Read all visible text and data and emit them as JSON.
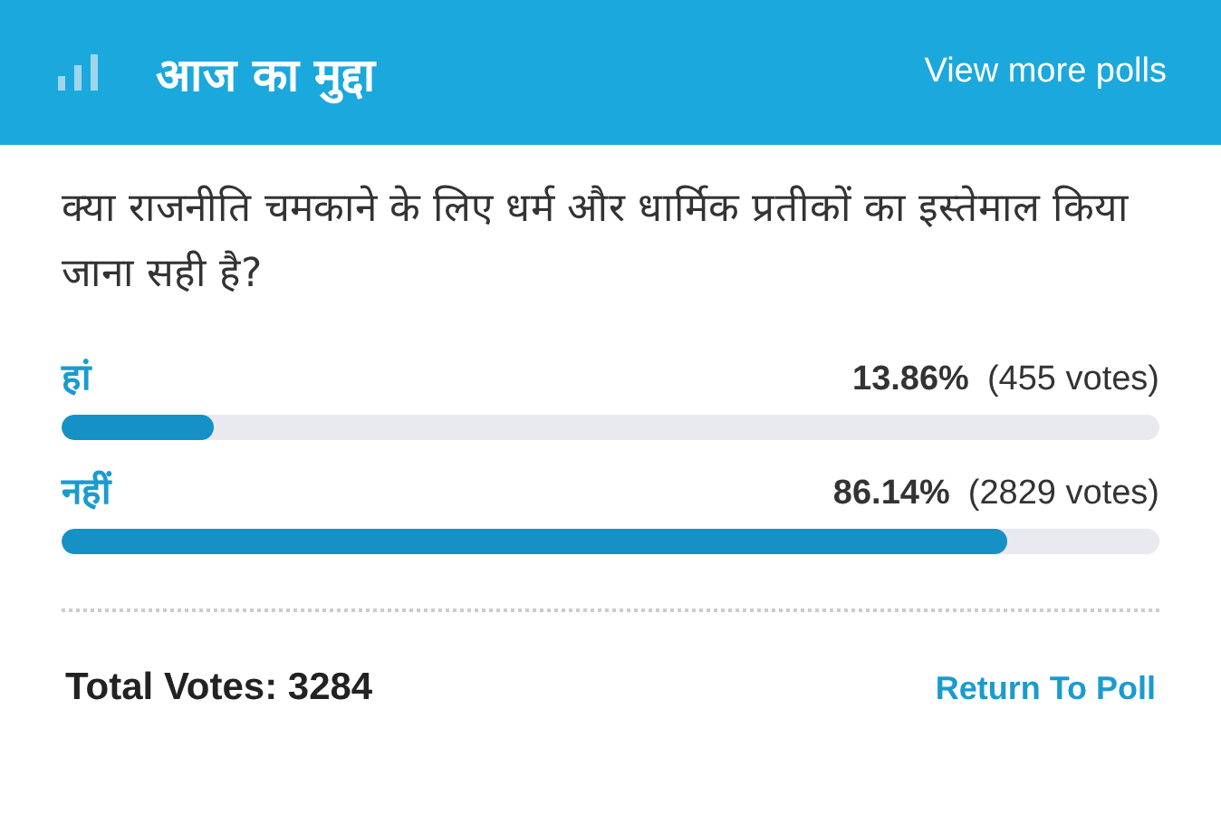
{
  "header": {
    "title": "आज का मुद्दा",
    "link": "View more polls"
  },
  "question": "क्या राजनीति चमकाने के लिए धर्म और धार्मिक प्रतीकों का इस्तेमाल किया जाना सही है?",
  "options": [
    {
      "label": "हां",
      "percent": "13.86%",
      "votes": "(455 votes)",
      "level": 0.1386
    },
    {
      "label": "नहीं",
      "percent": "86.14%",
      "votes": "(2829 votes)",
      "level": 0.8614
    }
  ],
  "footer": {
    "total": "Total Votes: 3284",
    "link": "Return To Poll"
  }
}
